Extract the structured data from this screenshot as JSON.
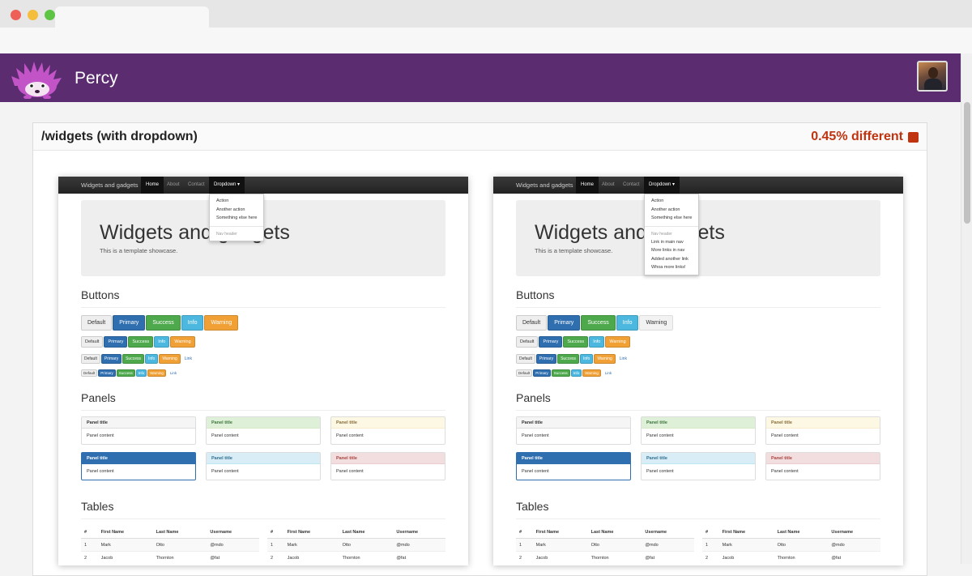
{
  "app": {
    "name": "Percy",
    "logo_icon": "hedgehog-logo-icon",
    "avatar_icon": "user-avatar-icon"
  },
  "snapshot": {
    "title": "/widgets (with dropdown)",
    "diff_label": "0.45% different",
    "diff_color": "#c0330f"
  },
  "site": {
    "brand": "Widgets and gadgets",
    "nav": [
      "Home",
      "About",
      "Contact"
    ],
    "dropdown_label": "Dropdown ▾",
    "dropdown_left": [
      "Action",
      "Another action",
      "Something else here"
    ],
    "dropdown_header": "Nav header",
    "dropdown_right_extra": [
      "Link in main nav",
      "More links in nav",
      "Added another link",
      "Whoa more links!"
    ],
    "jumbo_title": "Widgets and gadgets",
    "jumbo_text": "This is a template showcase.",
    "sections": {
      "buttons": "Buttons",
      "panels": "Panels",
      "tables": "Tables"
    },
    "buttons": {
      "default": "Default",
      "primary": "Primary",
      "success": "Success",
      "info": "Info",
      "warning": "Warning",
      "link": "Link"
    },
    "panel_title": "Panel title",
    "panel_content": "Panel content",
    "table": {
      "headers": [
        "#",
        "First Name",
        "Last Name",
        "Username"
      ],
      "rows": [
        [
          "1",
          "Mark",
          "Otto",
          "@mdo"
        ],
        [
          "2",
          "Jacob",
          "Thornton",
          "@fat"
        ]
      ]
    }
  }
}
